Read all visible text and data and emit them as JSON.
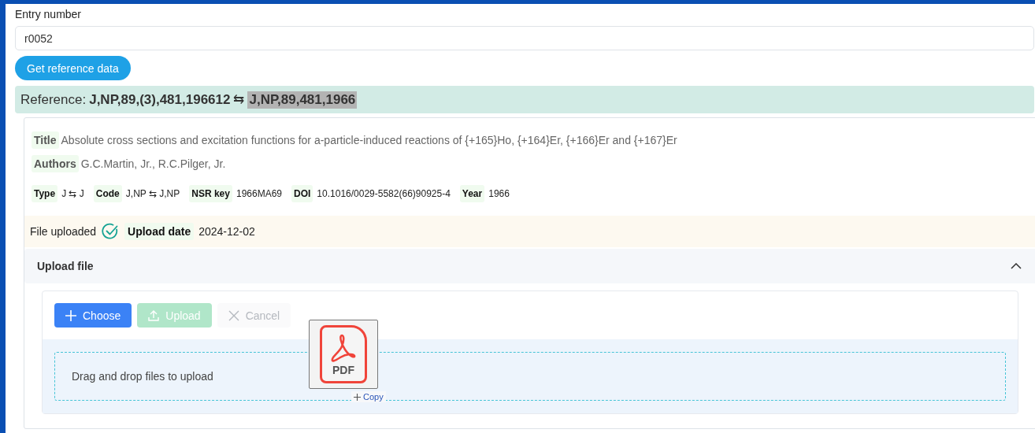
{
  "entry_number": {
    "label": "Entry number",
    "value": "r0052"
  },
  "get_button": "Get reference data",
  "reference": {
    "label": "Reference:",
    "original": "J,NP,89,(3),481,196612",
    "arrow": "⇆",
    "converted": "J,NP,89,481,1966",
    "highlighted": true
  },
  "title": {
    "label": "Title",
    "value": "Absolute cross sections and excitation functions for a-particle-induced reactions of {+165}Ho, {+164}Er, {+166}Er and {+167}Er"
  },
  "authors": {
    "label": "Authors",
    "value": "G.C.Martin, Jr., R.C.Pilger, Jr."
  },
  "meta": [
    {
      "label": "Type",
      "value": "J ⇆ J"
    },
    {
      "label": "Code",
      "value": "J,NP ⇆ J,NP"
    },
    {
      "label": "NSR key",
      "value": "1966MA69"
    },
    {
      "label": "DOI",
      "value": "10.1016/0029-5582(66)90925-4"
    },
    {
      "label": "Year",
      "value": "1966"
    }
  ],
  "upload_status": {
    "text": "File uploaded",
    "uploaded": true,
    "date_label": "Upload date",
    "date": "2024-12-02"
  },
  "upload_panel": {
    "title": "Upload file",
    "expanded": true,
    "buttons": [
      {
        "kind": "choose",
        "label": "Choose",
        "disabled": false
      },
      {
        "kind": "upload",
        "label": "Upload",
        "disabled": true
      },
      {
        "kind": "cancel",
        "label": "Cancel",
        "disabled": true
      }
    ],
    "dropzone_text": "Drag and drop files to upload",
    "drag_preview": {
      "label": "PDF",
      "action": "Copy"
    }
  }
}
